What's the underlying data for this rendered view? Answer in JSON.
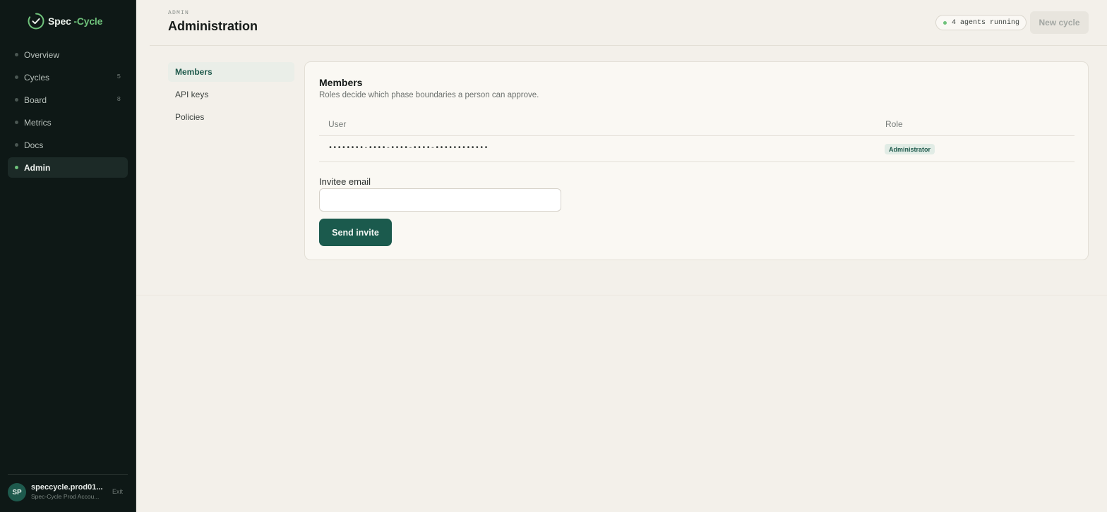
{
  "brand": {
    "name_part1": "Spec",
    "name_part2": "-Cycle",
    "accent_color": "#6fc27b"
  },
  "sidebar": {
    "items": [
      {
        "label": "Overview",
        "count": ""
      },
      {
        "label": "Cycles",
        "count": "5"
      },
      {
        "label": "Board",
        "count": "8"
      },
      {
        "label": "Metrics",
        "count": ""
      },
      {
        "label": "Docs",
        "count": ""
      },
      {
        "label": "Admin",
        "count": "",
        "active": true
      }
    ],
    "account": {
      "initials": "SP",
      "name": "speccycle.prod01...",
      "subtitle": "Spec-Cycle Prod Accou...",
      "exit_label": "Exit"
    }
  },
  "header": {
    "eyebrow": "ADMIN",
    "title": "Administration",
    "agents_status": "4 agents running",
    "new_cycle_label": "New cycle"
  },
  "subnav": {
    "items": [
      {
        "label": "Members",
        "active": true
      },
      {
        "label": "API keys"
      },
      {
        "label": "Policies"
      }
    ]
  },
  "members": {
    "title": "Members",
    "description": "Roles decide which phase boundaries a person can approve.",
    "columns": {
      "user": "User",
      "role": "Role"
    },
    "rows": [
      {
        "user": "••••••••-••••-••••-••••-••••••••••••",
        "role": "Administrator"
      }
    ],
    "invite_label": "Invitee email",
    "invite_value": "",
    "invite_placeholder": "",
    "send_label": "Send invite"
  },
  "colors": {
    "sidebar_bg": "#0e1816",
    "primary_button": "#1b5a4d",
    "page_bg": "#f3f0ea"
  }
}
